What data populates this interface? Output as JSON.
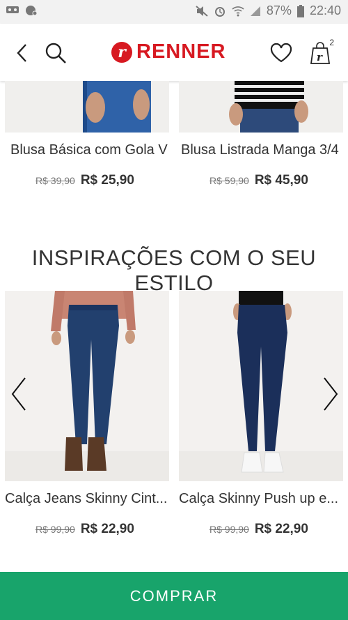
{
  "status_bar": {
    "battery": "87%",
    "time": "22:40"
  },
  "header": {
    "brand": "RENNER",
    "brand_mark": "r",
    "cart_count": "2"
  },
  "colors": {
    "brand_red": "#d71921",
    "buy_green": "#18a46b"
  },
  "top_products": [
    {
      "name": "Blusa Básica com Gola V",
      "old_price": "R$ 39,90",
      "price": "R$ 25,90"
    },
    {
      "name": "Blusa Listrada Manga 3/4",
      "old_price": "R$ 59,90",
      "price": "R$ 45,90"
    }
  ],
  "section": {
    "title": "INSPIRAÇÕES COM O SEU ESTILO"
  },
  "inspiration_products": [
    {
      "name": "Calça Jeans Skinny Cint...",
      "old_price": "R$ 99,90",
      "price": "R$ 22,90"
    },
    {
      "name": "Calça Skinny Push up e...",
      "old_price": "R$ 99,90",
      "price": "R$ 22,90"
    }
  ],
  "buy_button": {
    "label": "COMPRAR"
  },
  "icons": [
    "voicemail-icon",
    "notification-icon",
    "mute-icon",
    "alarm-icon",
    "wifi-icon",
    "signal-icon",
    "battery-icon",
    "back-icon",
    "search-icon",
    "heart-icon",
    "bag-icon",
    "chevron-left-icon",
    "chevron-right-icon"
  ]
}
